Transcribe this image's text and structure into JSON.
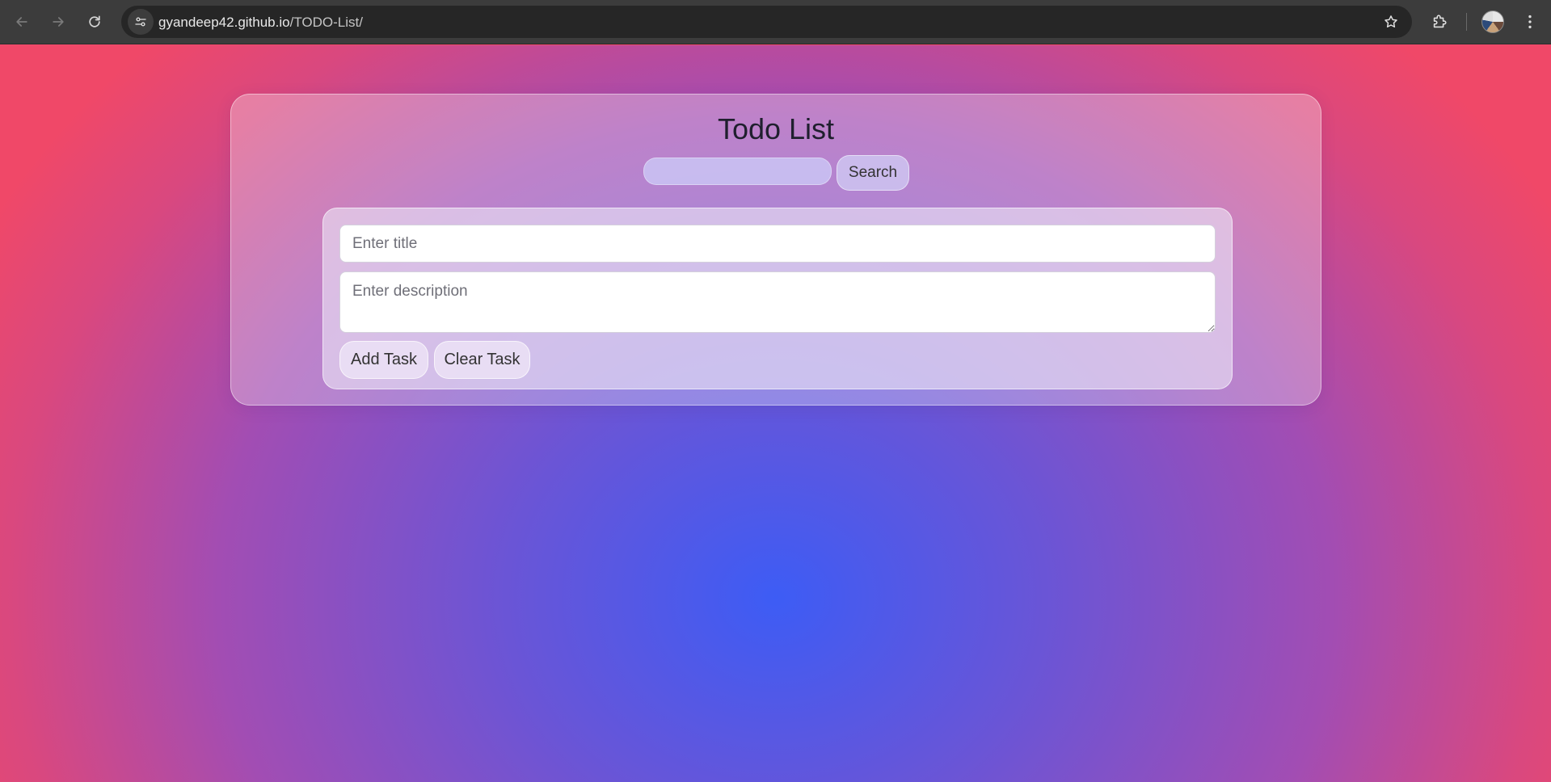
{
  "browser": {
    "url_host": "gyandeep42.github.io",
    "url_path": "/TODO-List/",
    "icons": {
      "back": "back-arrow-icon",
      "forward": "forward-arrow-icon",
      "reload": "reload-icon",
      "site_info": "tune-icon",
      "bookmark": "star-icon",
      "extensions": "puzzle-icon",
      "profile": "avatar",
      "menu": "kebab-menu-icon"
    }
  },
  "app": {
    "title": "Todo List",
    "search": {
      "value": "",
      "button_label": "Search"
    },
    "form": {
      "title_placeholder": "Enter title",
      "description_placeholder": "Enter description",
      "add_button_label": "Add Task",
      "clear_button_label": "Clear Task"
    }
  },
  "colors": {
    "background_center": "#3d5cf5",
    "background_edge": "#f04868",
    "text_dark": "#1f1f2e"
  }
}
